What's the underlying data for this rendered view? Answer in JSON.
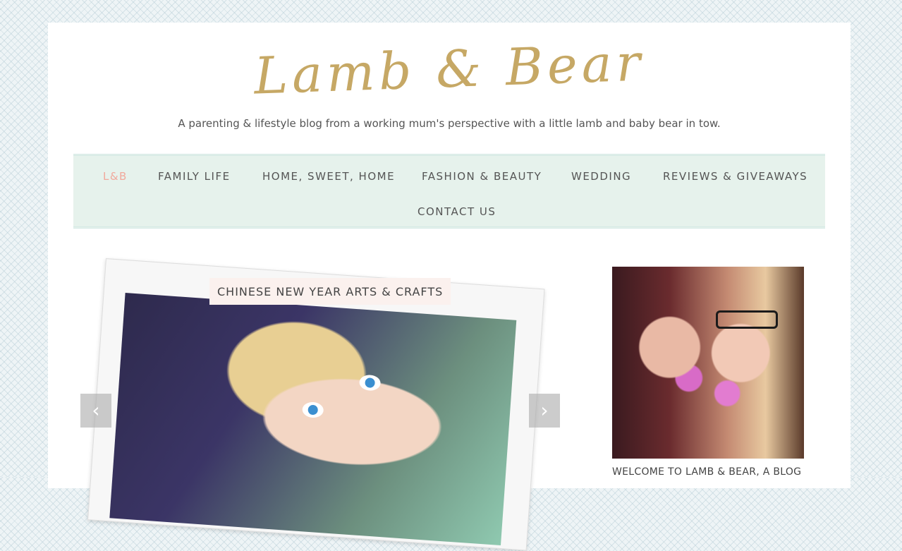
{
  "site": {
    "logo_text": "Lamb & Bear",
    "tagline": "A parenting & lifestyle blog from a working mum's perspective with a little lamb and baby bear in tow."
  },
  "nav": {
    "items": [
      {
        "label": "L&B",
        "active": true
      },
      {
        "label": "FAMILY LIFE",
        "active": false
      },
      {
        "label": "HOME, SWEET, HOME",
        "active": false
      },
      {
        "label": "FASHION & BEAUTY",
        "active": false
      },
      {
        "label": "WEDDING",
        "active": false
      },
      {
        "label": "REVIEWS & GIVEAWAYS",
        "active": false
      },
      {
        "label": "CONTACT US",
        "active": false
      }
    ]
  },
  "slider": {
    "slide_title": "CHINESE NEW YEAR ARTS & CRAFTS",
    "prev_icon": "‹",
    "next_icon": "›"
  },
  "sidebar": {
    "caption": "WELCOME TO LAMB & BEAR, A BLOG"
  },
  "colors": {
    "logo_gold": "#c6a865",
    "nav_bg": "#e6f2ec",
    "nav_active": "#f1a99c",
    "label_bg": "#fbf1ee"
  }
}
